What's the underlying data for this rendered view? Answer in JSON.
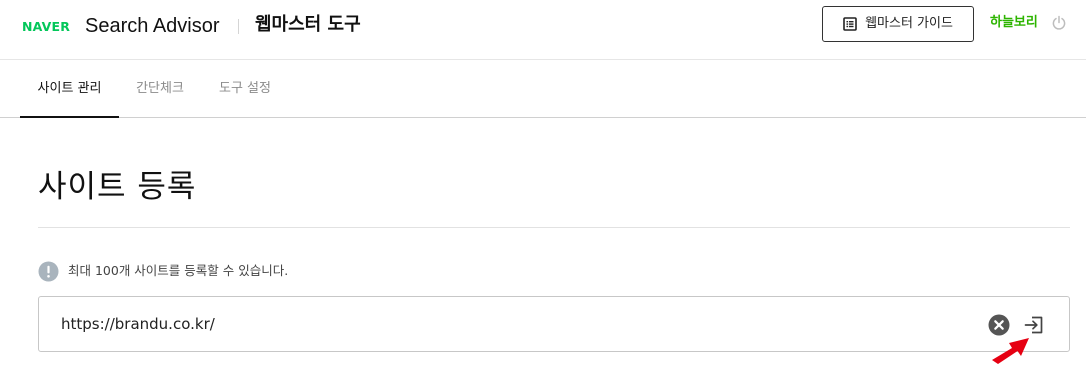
{
  "header": {
    "brand": "NAVER",
    "product": "Search Advisor",
    "tool_title": "웹마스터 도구",
    "guide_button": "웹마스터 가이드",
    "username": "하늘보리",
    "icons": {
      "guide": "document-list-icon",
      "logout": "power-icon"
    }
  },
  "tabs": [
    {
      "label": "사이트 관리",
      "active": true
    },
    {
      "label": "간단체크",
      "active": false
    },
    {
      "label": "도구 설정",
      "active": false
    }
  ],
  "main": {
    "title": "사이트 등록",
    "notice": "최대 100개 사이트를 등록할 수 있습니다.",
    "url_input": {
      "value": "https://brandu.co.kr/",
      "placeholder": ""
    },
    "icons": {
      "notice": "exclamation-circle-icon",
      "clear": "clear-circle-icon",
      "submit": "enter-arrow-icon"
    }
  },
  "colors": {
    "brand_green": "#03c75a",
    "username_green": "#2db400",
    "annotation_red": "#e60012"
  }
}
